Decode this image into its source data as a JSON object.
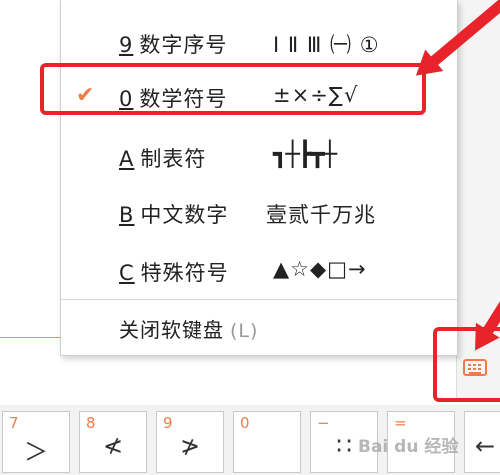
{
  "menu": {
    "items": [
      {
        "key": "9",
        "label": "数字序号",
        "sample": "Ⅰ Ⅱ Ⅲ ㈠ ①",
        "checked": false
      },
      {
        "key": "0",
        "label": "数学符号",
        "sample": "±×÷∑√",
        "checked": true
      },
      {
        "key": "A",
        "label": "制表符",
        "sample": "┓┼┣┳┼",
        "checked": false
      },
      {
        "key": "B",
        "label": "中文数字",
        "sample": "壹贰千万兆",
        "checked": false
      },
      {
        "key": "C",
        "label": "特殊符号",
        "sample": "▲☆◆□→",
        "checked": false
      }
    ],
    "check_mark": "✔",
    "close_label": "关闭软键盘",
    "close_hint": "(L)"
  },
  "keyboard_button": {
    "icon": "keyboard-icon"
  },
  "keys": [
    {
      "sub": "7",
      "main": "＞"
    },
    {
      "sub": "8",
      "main": "≮"
    },
    {
      "sub": "9",
      "main": "≯"
    },
    {
      "sub": "0",
      "main": ""
    },
    {
      "sub": "−",
      "main": "∷"
    },
    {
      "sub": "=",
      "main": ""
    },
    {
      "sub": "",
      "main": "←"
    }
  ],
  "watermark": "Bai du 经验",
  "colors": {
    "accent": "#f07b4a",
    "highlight": "#e8232a"
  }
}
